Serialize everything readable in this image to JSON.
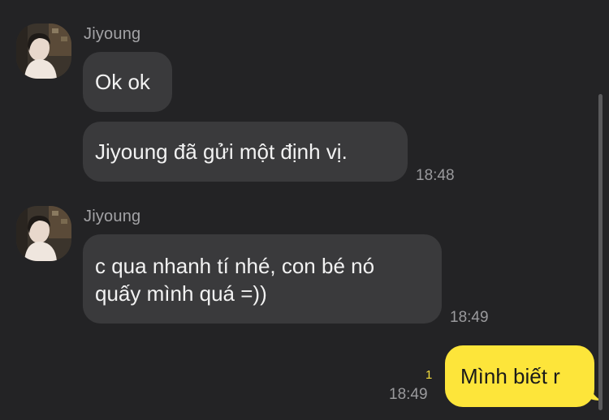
{
  "group1": {
    "sender": "Jiyoung",
    "messages": [
      {
        "text": "Ok ok"
      },
      {
        "text": "Jiyoung đã gửi một định vị.",
        "time": "18:48"
      }
    ]
  },
  "group2": {
    "sender": "Jiyoung",
    "messages": [
      {
        "line1": "c qua nhanh tí nhé, con bé nó",
        "line2": "quấy mình quá =))",
        "time": "18:49"
      }
    ]
  },
  "outgoing": {
    "text": "Mình biết r",
    "unread": "1",
    "time": "18:49"
  },
  "colors": {
    "background": "#232325",
    "incoming_bubble": "#3a3a3c",
    "outgoing_bubble": "#fde53a",
    "unread": "#f3dc3c"
  },
  "icons": {
    "avatar": "profile-photo-avatar"
  }
}
